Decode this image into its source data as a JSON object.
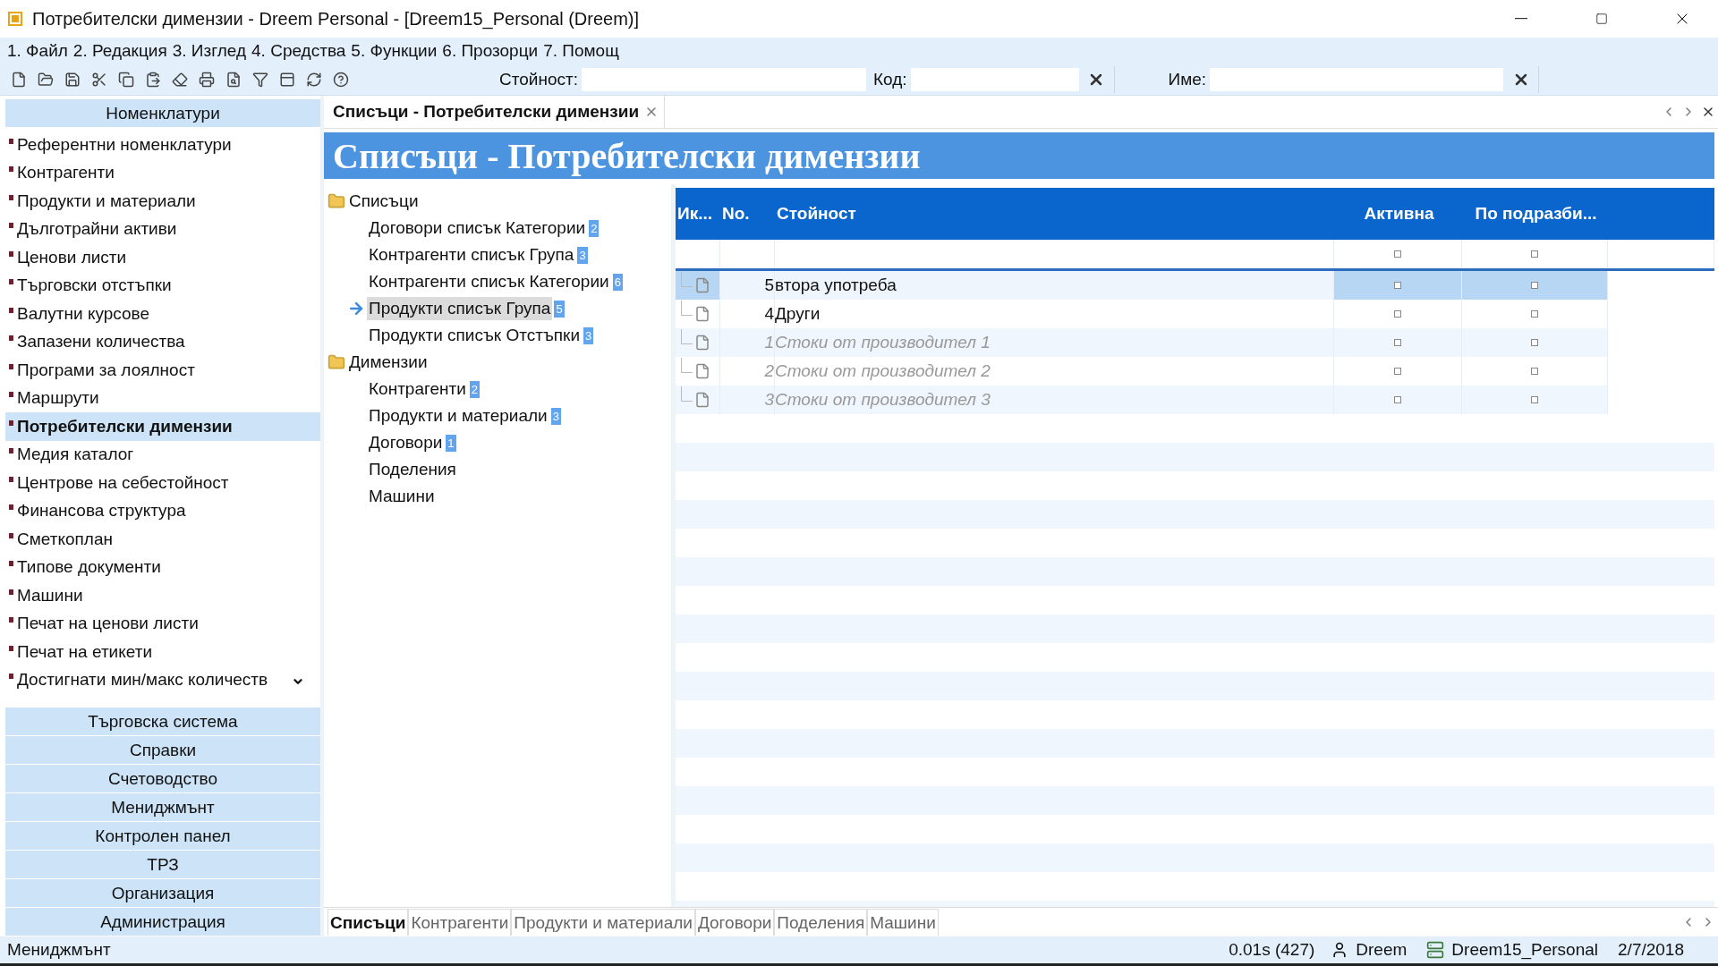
{
  "window": {
    "title": "Потребителски димензии - Dreem Personal - [Dreem15_Personal (Dreem)]"
  },
  "menu": [
    "1. Файл",
    "2. Редакция",
    "3. Изглед",
    "4. Средства",
    "5. Функции",
    "6. Прозорци",
    "7. Помощ"
  ],
  "toolbar": {
    "fields": [
      {
        "label": "Стойност:",
        "kind": "plain"
      },
      {
        "label": "Код:",
        "kind": "clearable"
      },
      {
        "label": "Име:",
        "kind": "clearable"
      }
    ]
  },
  "sidebar": {
    "header": "Номенклатури",
    "items": [
      {
        "label": "Референтни номенклатури",
        "selected": false
      },
      {
        "label": "Контрагенти",
        "selected": false
      },
      {
        "label": "Продукти и материали",
        "selected": false
      },
      {
        "label": "Дълготрайни активи",
        "selected": false
      },
      {
        "label": "Ценови листи",
        "selected": false
      },
      {
        "label": "Търговски отстъпки",
        "selected": false
      },
      {
        "label": "Валутни курсове",
        "selected": false
      },
      {
        "label": "Запазени количества",
        "selected": false
      },
      {
        "label": "Програми за лоялност",
        "selected": false
      },
      {
        "label": "Маршрути",
        "selected": false
      },
      {
        "label": "Потребителски димензии",
        "selected": true
      },
      {
        "label": "Медия каталог",
        "selected": false
      },
      {
        "label": "Центрове на себестойност",
        "selected": false
      },
      {
        "label": "Финансова структура",
        "selected": false
      },
      {
        "label": "Сметкоплан",
        "selected": false
      },
      {
        "label": "Типове документи",
        "selected": false
      },
      {
        "label": "Машини",
        "selected": false
      },
      {
        "label": "Печат на ценови листи",
        "selected": false
      },
      {
        "label": "Печат на етикети",
        "selected": false
      },
      {
        "label": "Достигнати мин/макс количеств",
        "selected": false
      }
    ],
    "sections": [
      "Търговска система",
      "Справки",
      "Счетоводство",
      "Мениджмънт",
      "Контролен панел",
      "ТРЗ",
      "Организация",
      "Администрация"
    ]
  },
  "document_tab": {
    "title": "Списъци - Потребителски димензии"
  },
  "page_title": "Списъци - Потребителски димензии",
  "tree": [
    {
      "label": "Списъци",
      "children": [
        {
          "label": "Договори списък Категории",
          "count": "2",
          "selected": false
        },
        {
          "label": "Контрагенти списък Група",
          "count": "3",
          "selected": false
        },
        {
          "label": "Контрагенти списък Категории",
          "count": "6",
          "selected": false
        },
        {
          "label": "Продукти списък Група",
          "count": "5",
          "selected": true
        },
        {
          "label": "Продукти списък Отстъпки",
          "count": "3",
          "selected": false
        }
      ]
    },
    {
      "label": "Димензии",
      "children": [
        {
          "label": "Контрагенти",
          "count": "2",
          "selected": false
        },
        {
          "label": "Продукти и материали",
          "count": "3",
          "selected": false
        },
        {
          "label": "Договори",
          "count": "1",
          "selected": false
        },
        {
          "label": "Поделения",
          "selected": false
        },
        {
          "label": "Машини",
          "selected": false
        }
      ]
    }
  ],
  "grid": {
    "columns": [
      "Ик...",
      "No.",
      "Стойност",
      "Активна",
      "По подразби..."
    ],
    "filter_row": {
      "active": false,
      "default": false
    },
    "rows": [
      {
        "no": "5",
        "value": "втора употреба",
        "selected": true,
        "disabled": false,
        "active": false,
        "default": false
      },
      {
        "no": "4",
        "value": "Други",
        "selected": false,
        "disabled": false,
        "active": false,
        "default": false
      },
      {
        "no": "1",
        "value": "Стоки от производител 1",
        "selected": false,
        "disabled": true,
        "active": false,
        "default": false
      },
      {
        "no": "2",
        "value": "Стоки от производител 2",
        "selected": false,
        "disabled": true,
        "active": false,
        "default": false
      },
      {
        "no": "3",
        "value": "Стоки от производител 3",
        "selected": false,
        "disabled": true,
        "active": false,
        "default": false
      }
    ]
  },
  "bottom_tabs": [
    {
      "label": "Списъци",
      "selected": true
    },
    {
      "label": "Контрагенти",
      "selected": false
    },
    {
      "label": "Продукти и материали",
      "selected": false
    },
    {
      "label": "Договори",
      "selected": false
    },
    {
      "label": "Поделения",
      "selected": false
    },
    {
      "label": "Машини",
      "selected": false
    }
  ],
  "status_bar": {
    "left": "Мениджмънт",
    "timing": "0.01s (427)",
    "user": "Dreem",
    "database": "Dreem15_Personal",
    "date": "2/7/2018"
  }
}
